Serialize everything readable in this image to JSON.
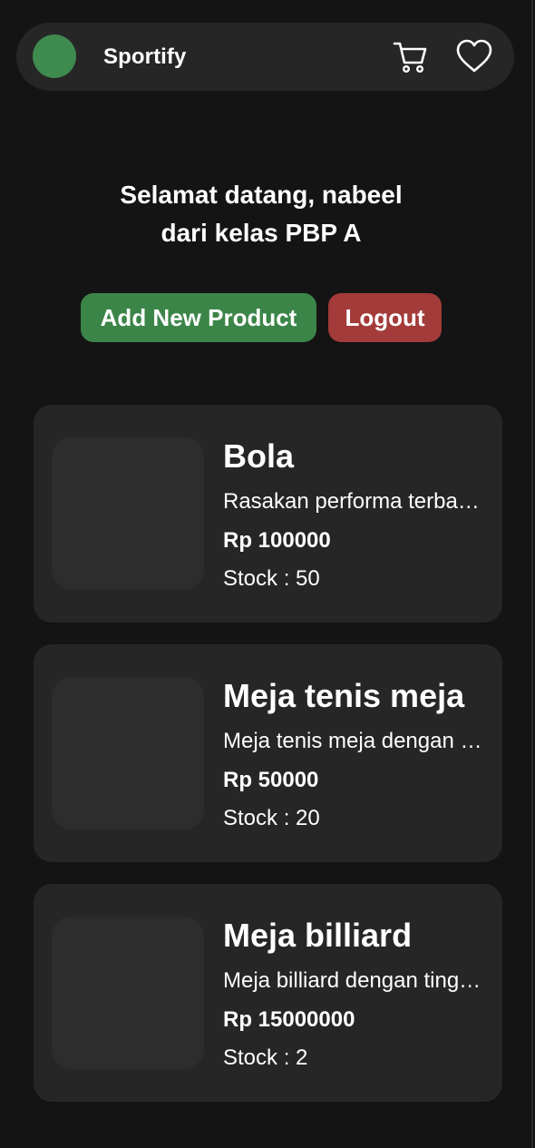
{
  "header": {
    "brand": "Sportify",
    "icons": [
      "cart-icon",
      "heart-icon"
    ],
    "logo_color": "#3f8a4e"
  },
  "welcome": {
    "line1": "Selamat datang, nabeel",
    "line2": "dari kelas PBP A"
  },
  "actions": {
    "add_label": "Add New Product",
    "logout_label": "Logout",
    "add_color": "#3c8548",
    "logout_color": "#a23b39"
  },
  "products": [
    {
      "name": "Bola",
      "description": "Rasakan performa terbaik dengan bola kami",
      "price": "Rp 100000",
      "stock": "Stock : 50"
    },
    {
      "name": "Meja tenis meja",
      "description": "Meja tenis meja dengan kualitas terbaik",
      "price": "Rp 50000",
      "stock": "Stock : 20"
    },
    {
      "name": "Meja billiard",
      "description": "Meja billiard dengan tingkat presisi tinggi",
      "price": "Rp 15000000",
      "stock": "Stock : 2"
    }
  ]
}
